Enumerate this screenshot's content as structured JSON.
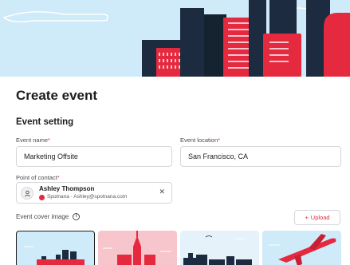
{
  "page": {
    "title": "Create event"
  },
  "section": {
    "title": "Event setting"
  },
  "fields": {
    "event_name": {
      "label": "Event name",
      "value": "Marketing Offsite"
    },
    "event_location": {
      "label": "Event location",
      "value": "San Francisco, CA"
    }
  },
  "point_of_contact": {
    "label": "Point of contact",
    "name": "Ashley Thompson",
    "company": "Spotnana",
    "separator": "·",
    "email": "Ashley@spotnana.com"
  },
  "cover": {
    "label": "Event cover image",
    "upload_label": "Upload",
    "thumbnails": [
      {
        "name": "city-skyline-navy",
        "selected": true
      },
      {
        "name": "pink-tower",
        "selected": false
      },
      {
        "name": "bridge-skyline",
        "selected": false
      },
      {
        "name": "red-airplane",
        "selected": false
      }
    ]
  },
  "required_marker": "*",
  "icons": {
    "avatar": "person-icon",
    "close": "close-icon",
    "info": "info-icon",
    "add": "plus-icon"
  },
  "colors": {
    "accent": "#e5293f",
    "navy": "#1c2b3f",
    "sky": "#cfeaf8",
    "pink": "#f6c6cc"
  }
}
